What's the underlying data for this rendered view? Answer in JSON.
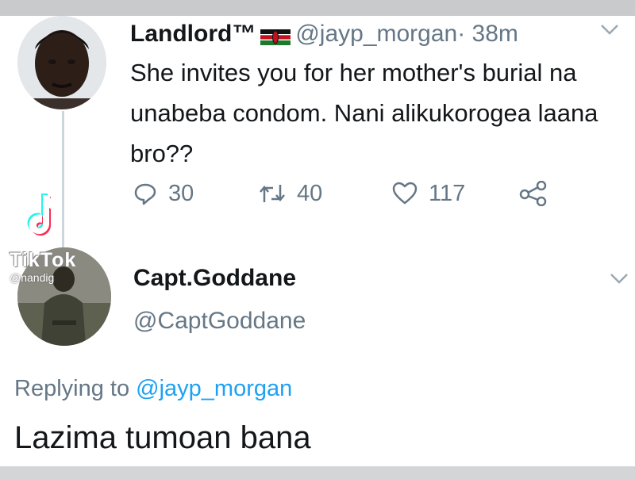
{
  "tweet": {
    "author_name": "Landlord™",
    "handle": "@jayp_morgan",
    "time": "· 38m",
    "text": "She invites you for her mother's  burial na unabeba condom. Nani alikukorogea laana bro??",
    "counts": {
      "replies": "30",
      "retweets": "40",
      "likes": "117"
    }
  },
  "watermark": {
    "brand": "TikTok",
    "user": "@nandig"
  },
  "reply": {
    "author_name": "Capt.Goddane",
    "handle": "@CaptGoddane",
    "replying_prefix": "Replying to",
    "replying_to": "@jayp_morgan",
    "text": "Lazima tumoan bana"
  },
  "colors": {
    "text": "#14171a",
    "secondary": "#657786",
    "link": "#1da1f2"
  },
  "icons": [
    "reply-icon",
    "retweet-icon",
    "like-icon",
    "share-icon",
    "chevron-down-icon",
    "kenya-flag-icon",
    "tiktok-logo-icon"
  ]
}
